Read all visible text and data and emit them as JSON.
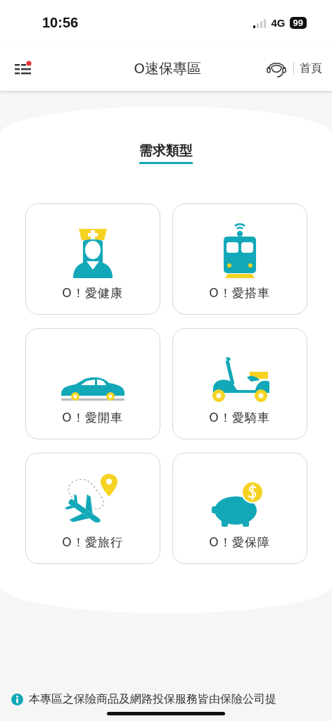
{
  "status_bar": {
    "time": "10:56",
    "network": "4G",
    "battery": "99"
  },
  "header": {
    "title": "O速保專區",
    "home_link": "首頁",
    "menu_badge": true
  },
  "section": {
    "title": "需求類型"
  },
  "categories": [
    {
      "label": "O！愛健康",
      "kind": "nurse"
    },
    {
      "label": "O！愛搭車",
      "kind": "train"
    },
    {
      "label": "O！愛開車",
      "kind": "car"
    },
    {
      "label": "O！愛騎車",
      "kind": "scooter"
    },
    {
      "label": "O！愛旅行",
      "kind": "plane"
    },
    {
      "label": "O！愛保障",
      "kind": "piggy"
    }
  ],
  "notice": {
    "text": "本專區之保險商品及網路投保服務皆由保險公司提"
  }
}
